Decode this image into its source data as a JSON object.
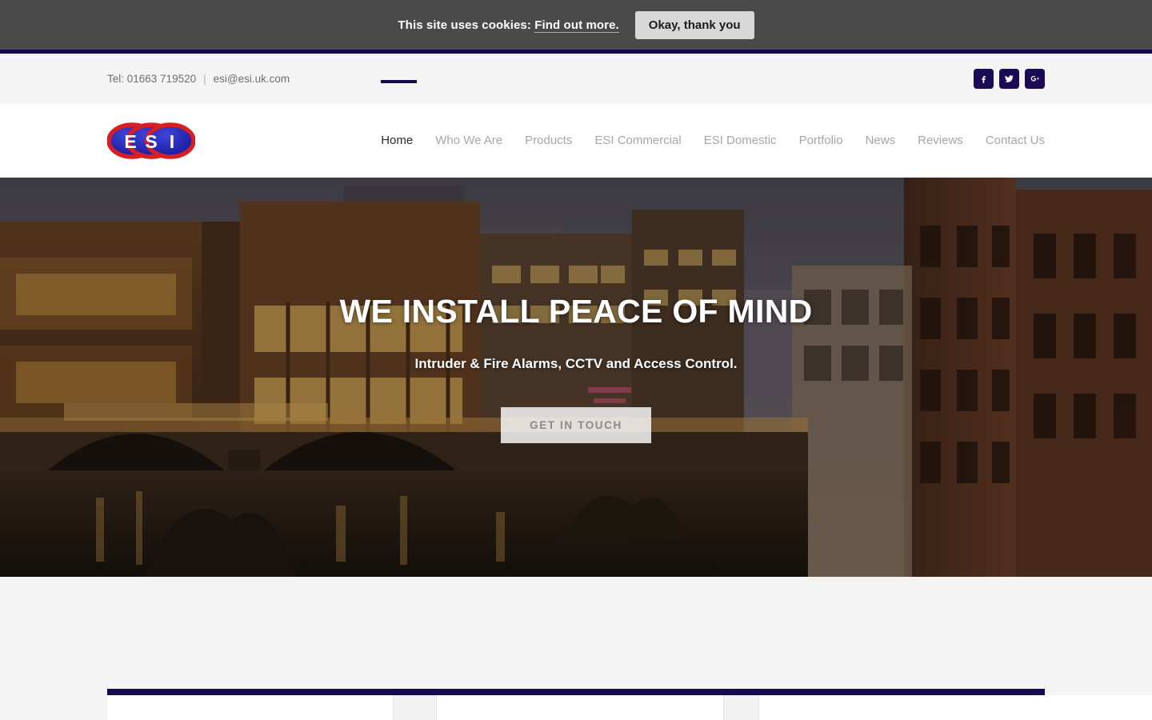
{
  "cookie": {
    "message": "This site uses cookies:",
    "link_label": "Find out more.",
    "accept_label": "Okay, thank you"
  },
  "topbar": {
    "phone": "Tel: 01663 719520",
    "separator": "|",
    "email": "esi@esi.uk.com",
    "social": [
      {
        "name": "facebook",
        "label": "f"
      },
      {
        "name": "twitter",
        "label": "t"
      },
      {
        "name": "google-plus",
        "label": "G+"
      }
    ]
  },
  "brand": {
    "logo_text": "ESI",
    "letters": [
      "E",
      "S",
      "I"
    ],
    "logo_ring_color": "#d81e20",
    "logo_fill_color": "#1f23a8"
  },
  "nav": {
    "items": [
      {
        "label": "Home",
        "active": true
      },
      {
        "label": "Who We Are",
        "active": false
      },
      {
        "label": "Products",
        "active": false
      },
      {
        "label": "ESI Commercial",
        "active": false
      },
      {
        "label": "ESI Domestic",
        "active": false
      },
      {
        "label": "Portfolio",
        "active": false
      },
      {
        "label": "News",
        "active": false
      },
      {
        "label": "Reviews",
        "active": false
      },
      {
        "label": "Contact Us",
        "active": false
      }
    ]
  },
  "hero": {
    "title": "WE INSTALL PEACE OF MIND",
    "subtitle": "Intruder & Fire Alarms, CCTV and Access Control.",
    "cta_label": "GET IN TOUCH",
    "image_description": "Dusk cityscape with canal, stone arch bridge and illuminated buildings"
  },
  "colors": {
    "navy": "#150a4e",
    "cookie_bar": "#4a4a4a",
    "page_gray": "#f4f4f4",
    "nav_inactive": "#a6a6ac",
    "nav_active": "#2a2a35"
  }
}
